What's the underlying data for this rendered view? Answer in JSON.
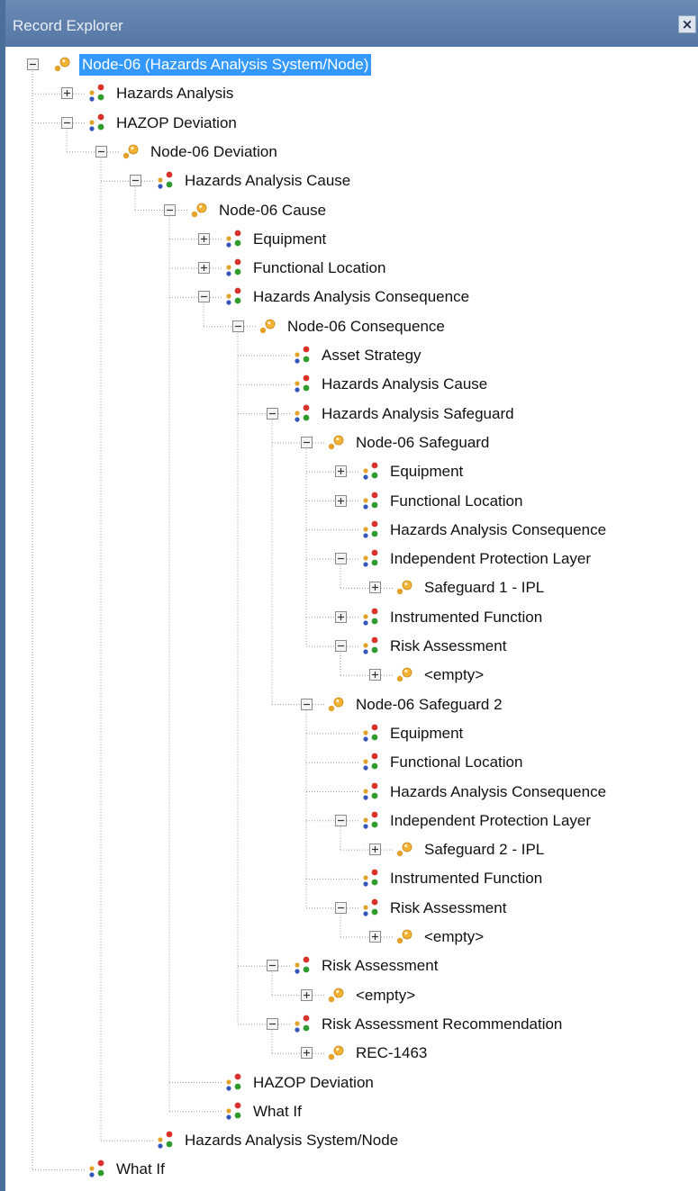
{
  "window": {
    "title": "Record Explorer",
    "close_symbol": "×"
  },
  "colors": {
    "frame": "#4a6f98",
    "title_bar": "#5f80ad",
    "selection": "#3399ff",
    "connector": "#9a9a9a"
  },
  "icons": {
    "record": "record-node-icon (orange bullet with dot)",
    "family": "family-link-icon (red, green, blue bullets)"
  },
  "tree": [
    {
      "label": "Node-06 (Hazards Analysis System/Node)",
      "level": 0,
      "icon": "record",
      "expander": "minus",
      "selected": true
    },
    {
      "label": "Hazards Analysis",
      "level": 1,
      "icon": "family",
      "expander": "plus"
    },
    {
      "label": "HAZOP Deviation",
      "level": 1,
      "icon": "family",
      "expander": "minus"
    },
    {
      "label": "Node-06 Deviation",
      "level": 2,
      "icon": "record",
      "expander": "minus"
    },
    {
      "label": "Hazards Analysis Cause",
      "level": 3,
      "icon": "family",
      "expander": "minus"
    },
    {
      "label": "Node-06 Cause",
      "level": 4,
      "icon": "record",
      "expander": "minus"
    },
    {
      "label": "Equipment",
      "level": 5,
      "icon": "family",
      "expander": "plus"
    },
    {
      "label": "Functional Location",
      "level": 5,
      "icon": "family",
      "expander": "plus"
    },
    {
      "label": "Hazards Analysis Consequence",
      "level": 5,
      "icon": "family",
      "expander": "minus"
    },
    {
      "label": "Node-06 Consequence",
      "level": 6,
      "icon": "record",
      "expander": "minus"
    },
    {
      "label": "Asset Strategy",
      "level": 7,
      "icon": "family",
      "expander": "none"
    },
    {
      "label": "Hazards Analysis Cause",
      "level": 7,
      "icon": "family",
      "expander": "none"
    },
    {
      "label": "Hazards Analysis Safeguard",
      "level": 7,
      "icon": "family",
      "expander": "minus"
    },
    {
      "label": "Node-06 Safeguard",
      "level": 8,
      "icon": "record",
      "expander": "minus"
    },
    {
      "label": "Equipment",
      "level": 9,
      "icon": "family",
      "expander": "plus"
    },
    {
      "label": "Functional Location",
      "level": 9,
      "icon": "family",
      "expander": "plus"
    },
    {
      "label": "Hazards Analysis Consequence",
      "level": 9,
      "icon": "family",
      "expander": "none"
    },
    {
      "label": "Independent Protection Layer",
      "level": 9,
      "icon": "family",
      "expander": "minus"
    },
    {
      "label": "Safeguard 1 - IPL",
      "level": 10,
      "icon": "record",
      "expander": "plus"
    },
    {
      "label": "Instrumented Function",
      "level": 9,
      "icon": "family",
      "expander": "plus"
    },
    {
      "label": "Risk Assessment",
      "level": 9,
      "icon": "family",
      "expander": "minus"
    },
    {
      "label": "<empty>",
      "level": 10,
      "icon": "record",
      "expander": "plus"
    },
    {
      "label": "Node-06 Safeguard 2",
      "level": 8,
      "icon": "record",
      "expander": "minus"
    },
    {
      "label": "Equipment",
      "level": 9,
      "icon": "family",
      "expander": "none"
    },
    {
      "label": "Functional Location",
      "level": 9,
      "icon": "family",
      "expander": "none"
    },
    {
      "label": "Hazards Analysis Consequence",
      "level": 9,
      "icon": "family",
      "expander": "none"
    },
    {
      "label": "Independent Protection Layer",
      "level": 9,
      "icon": "family",
      "expander": "minus"
    },
    {
      "label": "Safeguard 2 - IPL",
      "level": 10,
      "icon": "record",
      "expander": "plus"
    },
    {
      "label": "Instrumented Function",
      "level": 9,
      "icon": "family",
      "expander": "none"
    },
    {
      "label": "Risk Assessment",
      "level": 9,
      "icon": "family",
      "expander": "minus"
    },
    {
      "label": "<empty>",
      "level": 10,
      "icon": "record",
      "expander": "plus"
    },
    {
      "label": "Risk Assessment",
      "level": 7,
      "icon": "family",
      "expander": "minus"
    },
    {
      "label": "<empty>",
      "level": 8,
      "icon": "record",
      "expander": "plus"
    },
    {
      "label": "Risk Assessment Recommendation",
      "level": 7,
      "icon": "family",
      "expander": "minus"
    },
    {
      "label": "REC-1463",
      "level": 8,
      "icon": "record",
      "expander": "plus"
    },
    {
      "label": "HAZOP Deviation",
      "level": 5,
      "icon": "family",
      "expander": "none"
    },
    {
      "label": "What If",
      "level": 5,
      "icon": "family",
      "expander": "none"
    },
    {
      "label": "Hazards Analysis System/Node",
      "level": 3,
      "icon": "family",
      "expander": "none"
    },
    {
      "label": "What If",
      "level": 1,
      "icon": "family",
      "expander": "none"
    }
  ]
}
